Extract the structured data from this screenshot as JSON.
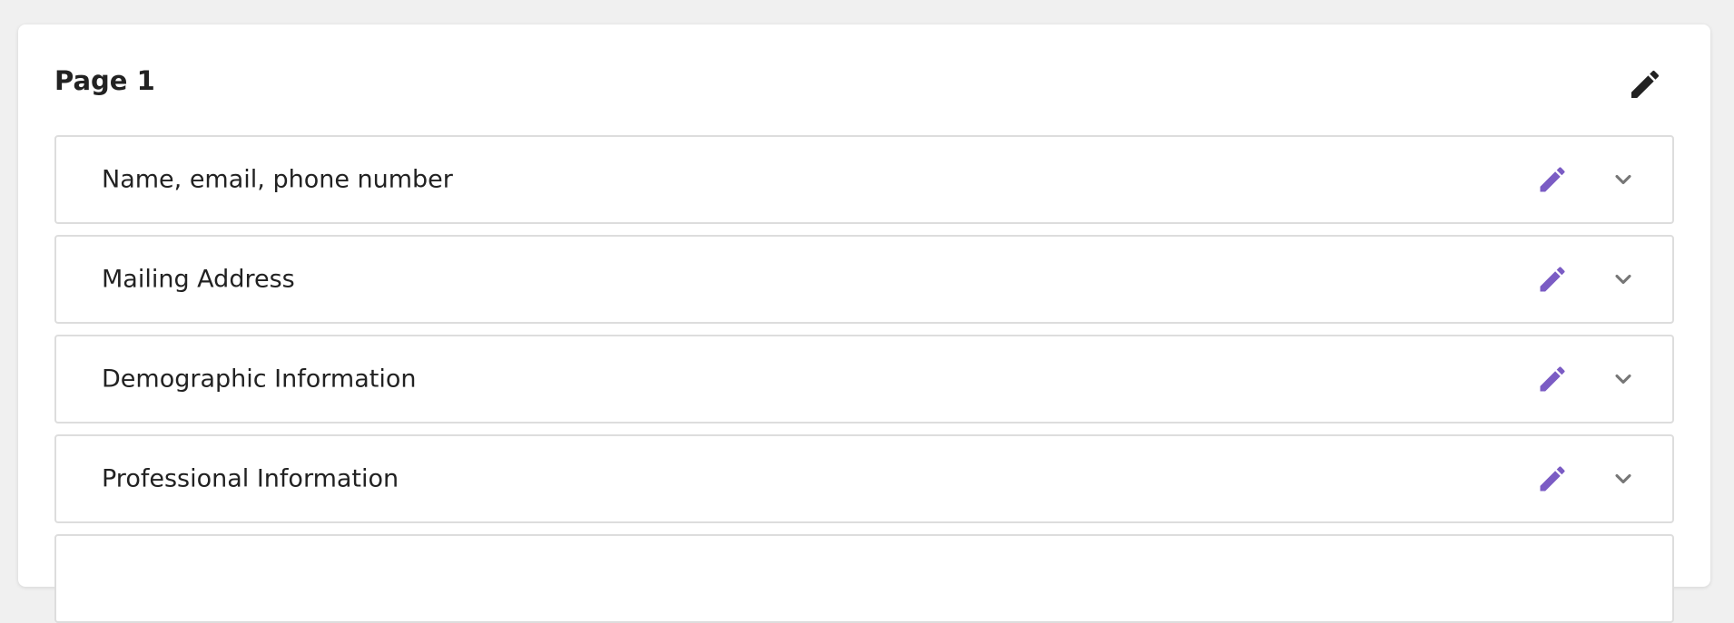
{
  "page": {
    "title": "Page 1"
  },
  "colors": {
    "accent": "#7b5cc4",
    "header_icon": "#222222",
    "chevron": "#777777"
  },
  "icons": {
    "header_edit": "pencil-icon",
    "section_edit": "pencil-icon",
    "section_toggle": "chevron-down-icon"
  },
  "sections": [
    {
      "label": "Name, email, phone number"
    },
    {
      "label": "Mailing Address"
    },
    {
      "label": "Demographic Information"
    },
    {
      "label": "Professional Information"
    },
    {
      "label": ""
    }
  ]
}
